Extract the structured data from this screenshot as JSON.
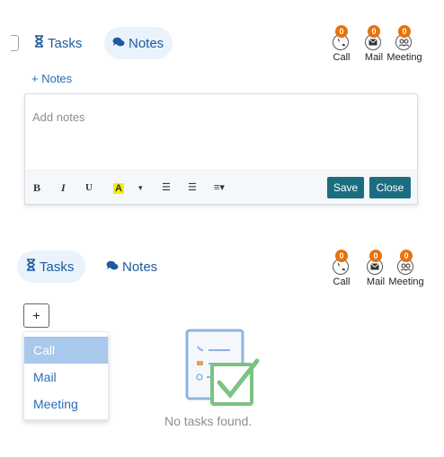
{
  "top_panel": {
    "tabs": [
      {
        "label": "Tasks",
        "icon": "hourglass-icon",
        "active": false
      },
      {
        "label": "Notes",
        "icon": "comments-icon",
        "active": true
      }
    ],
    "activities": [
      {
        "label": "Call",
        "count": "0",
        "icon": "phone-icon"
      },
      {
        "label": "Mail",
        "count": "0",
        "icon": "mail-icon"
      },
      {
        "label": "Meeting",
        "count": "0",
        "icon": "meeting-icon"
      }
    ],
    "add_notes_link": "+ Notes",
    "editor": {
      "placeholder": "Add notes",
      "toolbar": {
        "bold": "B",
        "italic": "I",
        "underline": "U",
        "highlight": "A",
        "caret": "▾",
        "ul": "☰",
        "ol": "☰",
        "align": "≡▾"
      },
      "save_label": "Save",
      "close_label": "Close"
    }
  },
  "bottom_panel": {
    "tabs": [
      {
        "label": "Tasks",
        "icon": "hourglass-icon",
        "active": true
      },
      {
        "label": "Notes",
        "icon": "comments-icon",
        "active": false
      }
    ],
    "activities": [
      {
        "label": "Call",
        "count": "0",
        "icon": "phone-icon"
      },
      {
        "label": "Mail",
        "count": "0",
        "icon": "mail-icon"
      },
      {
        "label": "Meeting",
        "count": "0",
        "icon": "meeting-icon"
      }
    ],
    "add_button": "+",
    "dropdown": [
      {
        "label": "Call",
        "selected": true
      },
      {
        "label": "Mail",
        "selected": false
      },
      {
        "label": "Meeting",
        "selected": false
      }
    ],
    "empty_text": "No tasks found."
  },
  "colors": {
    "accent": "#1d5a9c",
    "badge": "#e8720c",
    "button": "#1a6e80",
    "selected_item": "#a8c8ec",
    "check_green": "#7ac47f"
  }
}
